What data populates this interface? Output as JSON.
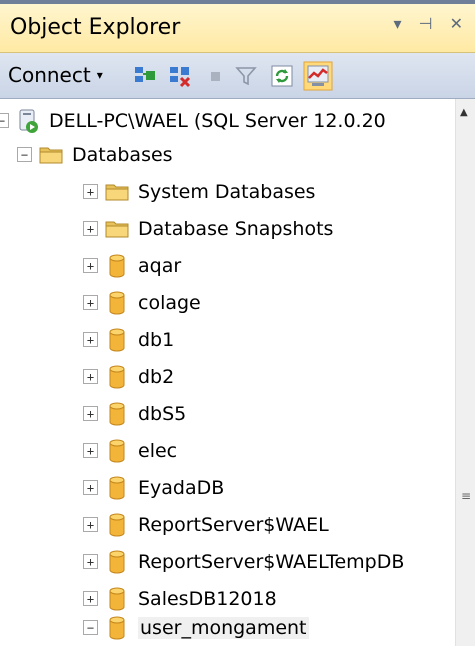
{
  "panel": {
    "title": "Object Explorer",
    "controls": "▾ ⊣ ✕",
    "colors": {
      "titlebar": "#ffe9a3",
      "toolbar": "#c9d4e6",
      "selection": "#f0f0f0"
    }
  },
  "toolbar": {
    "connect_label": "Connect",
    "caret": "▾",
    "icons": [
      "connect-object-explorer-icon",
      "disconnect-icon",
      "stop-icon",
      "filter-icon",
      "refresh-icon",
      "activity-monitor-icon"
    ]
  },
  "tree": {
    "server": {
      "label": "DELL-PC\\WAEL (SQL Server 12.0.20",
      "collapse": "−"
    },
    "databases": {
      "label": "Databases",
      "collapse": "−"
    },
    "items": [
      {
        "label": "System Databases",
        "type": "folder",
        "toggle": "+"
      },
      {
        "label": "Database Snapshots",
        "type": "folder",
        "toggle": "+"
      },
      {
        "label": "aqar",
        "type": "database",
        "toggle": "+"
      },
      {
        "label": "colage",
        "type": "database",
        "toggle": "+"
      },
      {
        "label": "db1",
        "type": "database",
        "toggle": "+"
      },
      {
        "label": "db2",
        "type": "database",
        "toggle": "+"
      },
      {
        "label": "dbS5",
        "type": "database",
        "toggle": "+"
      },
      {
        "label": "elec",
        "type": "database",
        "toggle": "+"
      },
      {
        "label": "EyadaDB",
        "type": "database",
        "toggle": "+"
      },
      {
        "label": "ReportServer$WAEL",
        "type": "database",
        "toggle": "+"
      },
      {
        "label": "ReportServer$WAELTempDB",
        "type": "database",
        "toggle": "+"
      },
      {
        "label": "SalesDB12018",
        "type": "database",
        "toggle": "+"
      },
      {
        "label": "user_mongament",
        "type": "database",
        "toggle": "−",
        "selected": true
      }
    ]
  },
  "scrollbar": {
    "up": "▲",
    "grip": "≡"
  }
}
